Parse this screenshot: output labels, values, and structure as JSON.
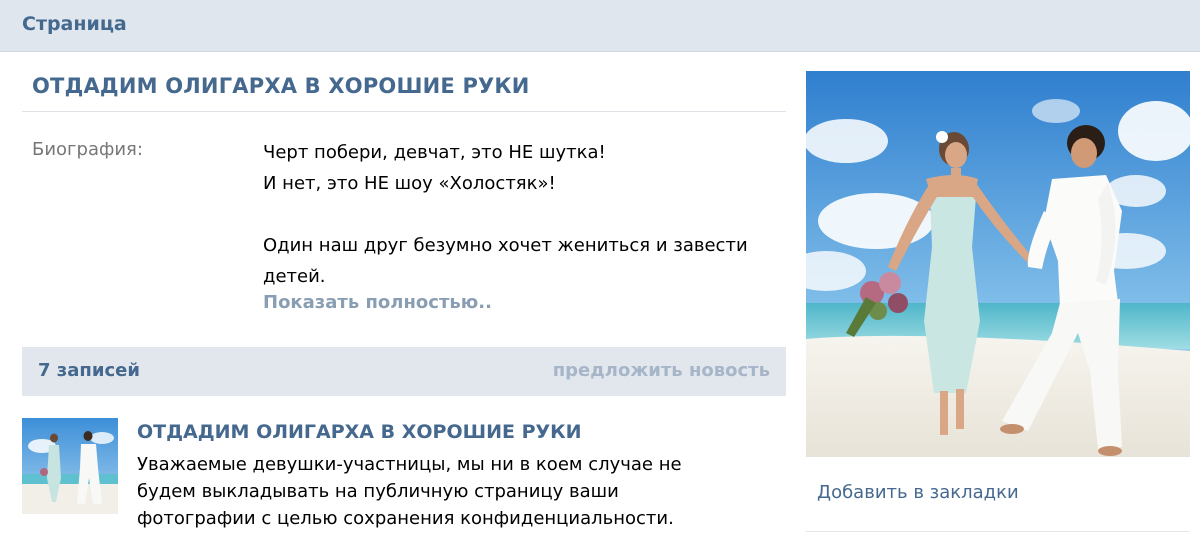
{
  "header": {
    "title": "Страница"
  },
  "page": {
    "title": "ОТДАДИМ ОЛИГАРХА В ХОРОШИЕ РУКИ",
    "bio": {
      "label": "Биография:",
      "lines": [
        "Черт побери, девчат, это НЕ шутка!",
        "И нет, это НЕ шоу «Холостяк»!",
        "Один наш друг безумно хочет жениться и завести",
        "детей."
      ],
      "show_more": "Показать полностью.."
    }
  },
  "posts": {
    "count_label": "7 записей",
    "suggest_label": "предложить новость",
    "items": [
      {
        "title": "ОТДАДИМ ОЛИГАРХА В ХОРОШИЕ РУКИ",
        "lines": [
          "Уважаемые девушки-участницы, мы ни в коем случае не",
          "будем выкладывать на публичную страницу ваши",
          "фотографии с целью сохранения конфиденциальности."
        ]
      }
    ]
  },
  "sidebar": {
    "bookmark_label": "Добавить в закладки"
  },
  "colors": {
    "accent": "#45688e",
    "header_bg": "#dfe6ee",
    "bar_bg": "#e1e7ed",
    "muted_link": "#a6b5c7"
  }
}
